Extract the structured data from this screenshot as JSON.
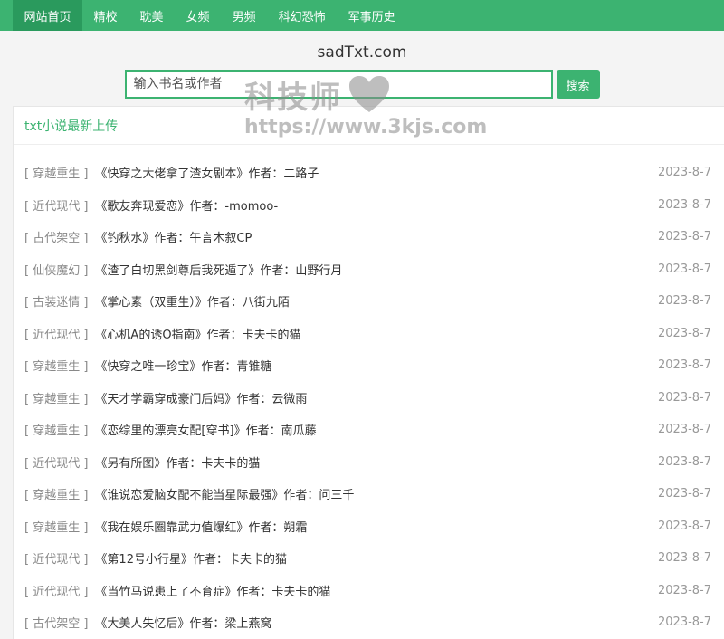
{
  "nav": {
    "items": [
      {
        "label": "网站首页",
        "active": true
      },
      {
        "label": "精校",
        "active": false
      },
      {
        "label": "耽美",
        "active": false
      },
      {
        "label": "女频",
        "active": false
      },
      {
        "label": "男频",
        "active": false
      },
      {
        "label": "科幻恐怖",
        "active": false
      },
      {
        "label": "军事历史",
        "active": false
      }
    ]
  },
  "site": {
    "title": "sadTxt.com"
  },
  "search": {
    "placeholder": "输入书名或作者",
    "button_label": "搜索"
  },
  "section": {
    "title": "txt小说最新上传"
  },
  "books": [
    {
      "category": "[ 穿越重生 ]",
      "title": "《快穿之大佬拿了渣女剧本》作者：二路子",
      "date": "2023-8-7"
    },
    {
      "category": "[ 近代现代 ]",
      "title": "《歌友奔现爱恋》作者：-momoo-",
      "date": "2023-8-7"
    },
    {
      "category": "[ 古代架空 ]",
      "title": "《钓秋水》作者：午言木叙CP",
      "date": "2023-8-7"
    },
    {
      "category": "[ 仙侠魔幻 ]",
      "title": "《渣了白切黑剑尊后我死遁了》作者：山野行月",
      "date": "2023-8-7"
    },
    {
      "category": "[ 古装迷情 ]",
      "title": "《掌心素（双重生）》作者：八街九陌",
      "date": "2023-8-7"
    },
    {
      "category": "[ 近代现代 ]",
      "title": "《心机A的诱O指南》作者：卡夫卡的猫",
      "date": "2023-8-7"
    },
    {
      "category": "[ 穿越重生 ]",
      "title": "《快穿之唯一珍宝》作者：青锥糖",
      "date": "2023-8-7"
    },
    {
      "category": "[ 穿越重生 ]",
      "title": "《天才学霸穿成豪门后妈》作者：云微雨",
      "date": "2023-8-7"
    },
    {
      "category": "[ 穿越重生 ]",
      "title": "《恋综里的漂亮女配[穿书]》作者：南瓜藤",
      "date": "2023-8-7"
    },
    {
      "category": "[ 近代现代 ]",
      "title": "《另有所图》作者：卡夫卡的猫",
      "date": "2023-8-7"
    },
    {
      "category": "[ 穿越重生 ]",
      "title": "《谁说恋爱脑女配不能当星际最强》作者：问三千",
      "date": "2023-8-7"
    },
    {
      "category": "[ 穿越重生 ]",
      "title": "《我在娱乐圈靠武力值爆红》作者：朔霜",
      "date": "2023-8-7"
    },
    {
      "category": "[ 近代现代 ]",
      "title": "《第12号小行星》作者：卡夫卡的猫",
      "date": "2023-8-7"
    },
    {
      "category": "[ 近代现代 ]",
      "title": "《当竹马说患上了不育症》作者：卡夫卡的猫",
      "date": "2023-8-7"
    },
    {
      "category": "[ 古代架空 ]",
      "title": "《大美人失忆后》作者：梁上燕窝",
      "date": "2023-8-7"
    }
  ],
  "watermark": {
    "text": "科技师",
    "url": "https://www.3kjs.com",
    "icon": "heart-icon"
  },
  "colors": {
    "accent": "#3cb371",
    "accent_dark": "#2a9a5d",
    "date": "#999999"
  }
}
